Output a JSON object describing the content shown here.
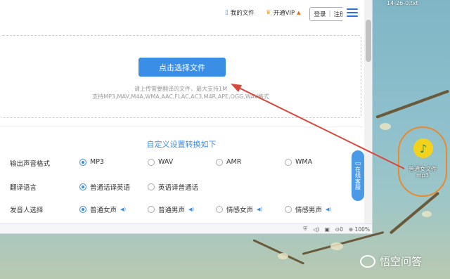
{
  "desktop": {
    "corner_text": "14-26-0.txt",
    "file_icon_label_line1": "普通女文件",
    "file_icon_label_line2": "mp3",
    "watermark_text": "悟空问答"
  },
  "topbar": {
    "my_files": "我的文件",
    "vip": "开通VIP",
    "login": "登录",
    "divider": "|",
    "register": "注册"
  },
  "upload": {
    "button_label": "点击选择文件",
    "hint_line1": "请上传需要翻译的文件，最大支持1M",
    "hint_line2": "支持MP3,MAV,M4A,WMA,AAC,FLAC,AC3,M4R,APE,OGG,WAV格式"
  },
  "settings": {
    "title": "自定义设置转换如下",
    "rows": [
      {
        "label": "输出声音格式",
        "options": [
          {
            "label": "MP3",
            "selected": true
          },
          {
            "label": "WAV",
            "selected": false
          },
          {
            "label": "AMR",
            "selected": false
          },
          {
            "label": "WMA",
            "selected": false
          }
        ]
      },
      {
        "label": "翻译语言",
        "options": [
          {
            "label": "普通话译英语",
            "selected": true
          },
          {
            "label": "英语译普通话",
            "selected": false
          }
        ]
      },
      {
        "label": "发音人选择",
        "options": [
          {
            "label": "普通女声",
            "selected": true
          },
          {
            "label": "普通男声",
            "selected": false
          },
          {
            "label": "情感女声",
            "selected": false
          },
          {
            "label": "情感男声",
            "selected": false
          }
        ]
      }
    ]
  },
  "float_tab": {
    "line1": "在",
    "line2": "线",
    "line3": "客",
    "line4": "服"
  },
  "statusbar": {
    "badge_count": "0",
    "zoom": "100%"
  },
  "colors": {
    "accent": "#3a8ee6",
    "annotation": "#d9463a",
    "highlight_ring": "#e78a2e"
  }
}
